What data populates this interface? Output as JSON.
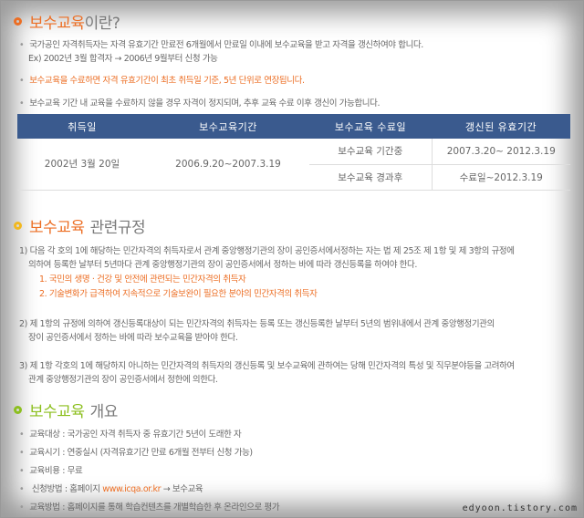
{
  "section1": {
    "title_main": "보수교육",
    "title_suffix": "이란?",
    "lines": [
      "국가공인 자격취득자는 자격 유효기간 만료전 6개월에서 만료일 이내에 보수교육을 받고 자격을 갱신하여야 합니다.",
      "Ex) 2002년 3월 합격자 → 2006년 9월부터 신청 가능",
      "보수교육을 수료하면 자격 유효기간이 최초 취득일 기준, 5년 단위로 연장됩니다.",
      "보수교육 기간 내 교육을 수료하지 않을 경우 자격이 정지되며, 추후 교육 수료 이후 갱신이 가능합니다."
    ]
  },
  "table": {
    "headers": [
      "취득일",
      "보수교육기간",
      "보수교육 수료일",
      "갱신된 유효기간"
    ],
    "acquired": "2002년 3월 20일",
    "period": "2006.9.20~2007.3.19",
    "rows": [
      {
        "status": "보수교육 기간중",
        "validity": "2007.3.20~ 2012.3.19"
      },
      {
        "status": "보수교육 경과후",
        "validity": "수료일~2012.3.19"
      }
    ]
  },
  "section2": {
    "title_main": "보수교육",
    "title_suffix": "관련규정",
    "p1a": "1) 다음 각 호의 1에 해당하는 민간자격의 취득자로서 관계 중앙행정기관의 장이 공인증서에서정하는 자는 법 제 25조 제 1항 및 제 3항의 규정에",
    "p1b": "의하여 등록한 날부터 5년마다 관계 중앙행정기관의 장이 공인증서에서 정하는 바에 따라 갱신등록을 하여야 한다.",
    "p1c": "1. 국민의 생명 · 건강 및 안전에 관련되는 민간자격의 취득자",
    "p1d": "2. 기술변화가 급격하여 지속적으로 기술보완이 필요한 분야의 민간자격의 취득자",
    "p2a": "2) 제 1항의 규정에 의하여 갱신등록대상이 되는 민간자격의 취득자는 등록 또는 갱신등록한 날부터 5년의 범위내에서 관계 중앙행정기관의",
    "p2b": "장이 공인증서에서 정하는 바에 따라 보수교육을 받아야 한다.",
    "p3a": "3) 제 1항 각호의 1에 해당하지 아니하는 민간자격의 취득자의 갱신등록 및 보수교육에 관하여는 당해 민간자격의 특성 및 직무분야등을 고려하여",
    "p3b": "관계 중앙행정기관의 장이 공인증서에서 정한에 의한다."
  },
  "section3": {
    "title_main": "보수교육",
    "title_suffix": "개요",
    "items": [
      "교육대상 : 국가공인 자격 취득자 중 유효기간 5년이 도래한 자",
      "교육시기 : 연중실시 (자격유효기간 만료 6개월 전부터 신청 가능)",
      "교육비용 : 무료"
    ],
    "apply_prefix": "신청방법 : 홈페이지 ",
    "apply_link": "www.icqa.or.kr",
    "apply_suffix": "  → 보수교육",
    "method": "교육방법 : 홈페이지를 통해 학습컨텐츠를 개별학습한 후 온라인으로 평가"
  },
  "watermark": "edyoon.tistory.com",
  "colors": {
    "orange": "#ec6e24",
    "green": "#8cbf1f",
    "header_blue": "#3a5a8e"
  }
}
